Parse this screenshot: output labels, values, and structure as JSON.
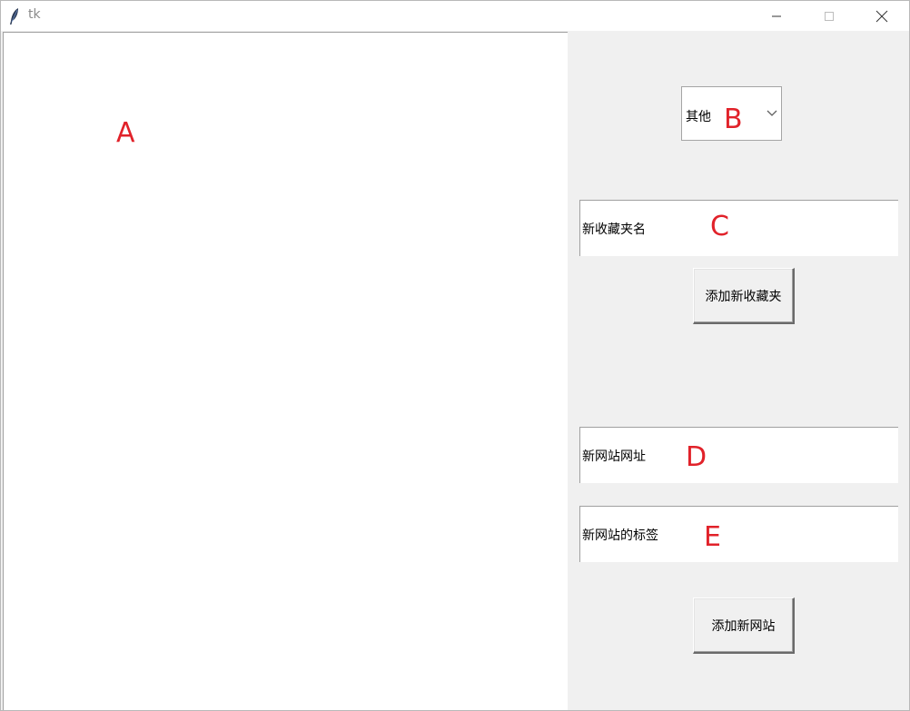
{
  "window": {
    "title": "tk",
    "controls": [
      "minimize-icon",
      "maximize-icon",
      "close-icon"
    ]
  },
  "combo": {
    "value": "其他"
  },
  "entries": {
    "folder_name": "新收藏夹名",
    "site_url": "新网站网址",
    "site_tag": "新网站的标签"
  },
  "buttons": {
    "add_folder": "添加新收藏夹",
    "add_site": "添加新网站"
  },
  "annotations": {
    "a": "A",
    "b": "B",
    "c": "C",
    "d": "D",
    "e": "E",
    "color": "#e1222a"
  },
  "colors": {
    "panel_bg": "#f0f0f0",
    "field_bg": "#ffffff"
  }
}
